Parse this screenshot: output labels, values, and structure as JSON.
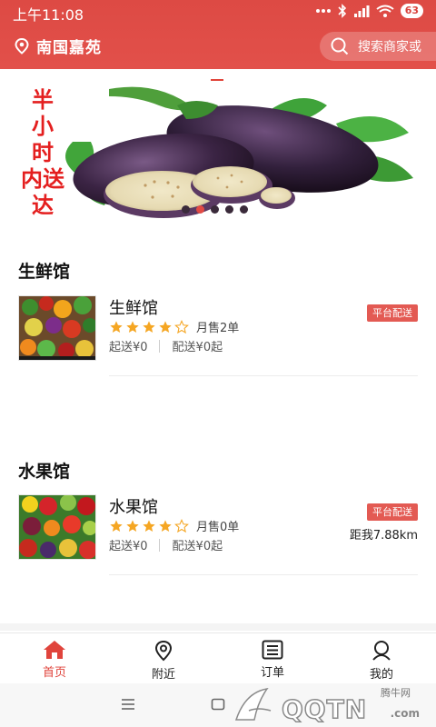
{
  "status_bar": {
    "time": "上午11:08",
    "battery": "63"
  },
  "app_bar": {
    "location": "南国嘉苑",
    "search_placeholder": "搜索商家或"
  },
  "banner": {
    "text_lines": [
      "半",
      "小",
      "时",
      "内送",
      "达"
    ],
    "dot_count": 5,
    "active_dot": 1
  },
  "sections": [
    {
      "title": "生鲜馆",
      "shop": {
        "name": "生鲜馆",
        "rating": 4,
        "monthly_sales": "月售2单",
        "min_order": "起送¥0",
        "delivery_fee": "配送¥0起",
        "badge": "平台配送",
        "distance": ""
      }
    },
    {
      "title": "水果馆",
      "shop": {
        "name": "水果馆",
        "rating": 4,
        "monthly_sales": "月售0单",
        "min_order": "起送¥0",
        "delivery_fee": "配送¥0起",
        "badge": "平台配送",
        "distance": "距我7.88km"
      }
    }
  ],
  "bottom_nav": [
    {
      "label": "首页",
      "icon": "home-icon",
      "active": true
    },
    {
      "label": "附近",
      "icon": "location-pin-icon",
      "active": false
    },
    {
      "label": "订单",
      "icon": "order-list-icon",
      "active": false
    },
    {
      "label": "我的",
      "icon": "user-icon",
      "active": false
    }
  ],
  "watermark": {
    "main": "QQTN",
    "small": "腾牛网",
    "suffix": ".com"
  },
  "colors": {
    "accent": "#e0443c",
    "badge": "#e35a53",
    "star": "#f5a623"
  }
}
